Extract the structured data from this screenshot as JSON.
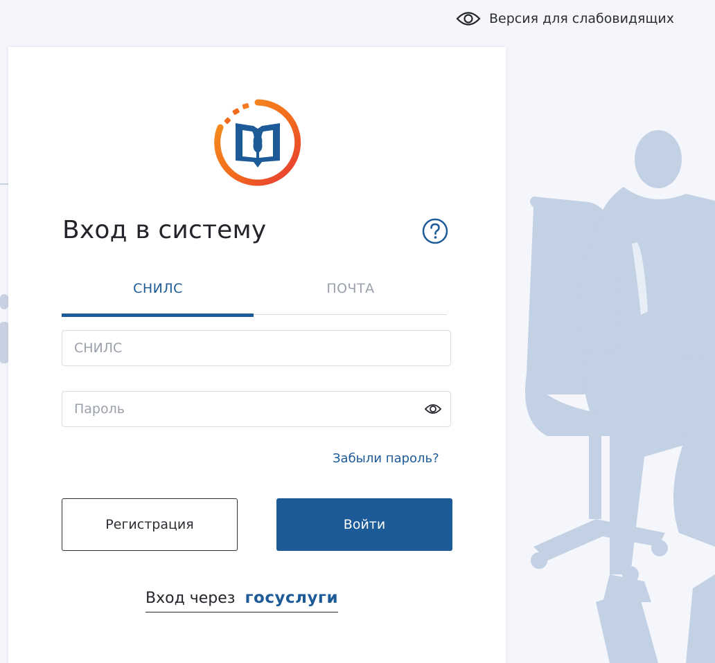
{
  "top_bar": {
    "a11y_icon": "eye-icon",
    "a11y_label": "Версия для слабовидящих"
  },
  "login_card": {
    "logo_icon": "book-logo-icon",
    "title": "Вход в систему",
    "help_icon": "question-circle-icon",
    "tabs": [
      {
        "label": "СНИЛС",
        "active": true
      },
      {
        "label": "ПОЧТА",
        "active": false
      }
    ],
    "snils_input": {
      "placeholder": "СНИЛС",
      "value": ""
    },
    "password_input": {
      "placeholder": "Пароль",
      "value": ""
    },
    "password_toggle_icon": "eye-icon",
    "forgot_password": "Забыли пароль?",
    "register_label": "Регистрация",
    "login_label": "Войти",
    "gosuslugi_prefix": "Вход через",
    "gosuslugi_brand": "госуслуги"
  },
  "colors": {
    "accent": "#1d5a98",
    "logo_orange": "#f26b1d",
    "logo_red": "#e53935",
    "background": "#f4f6fb"
  }
}
